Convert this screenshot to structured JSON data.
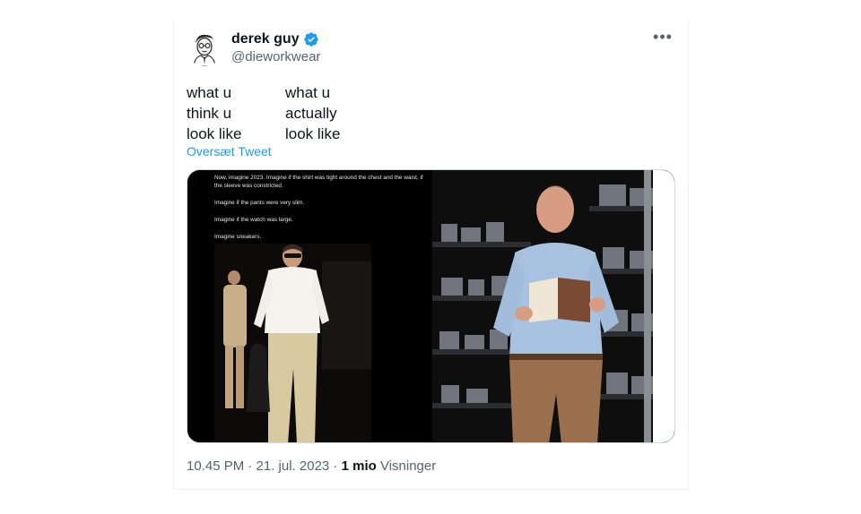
{
  "author": {
    "name": "derek guy",
    "handle": "@dieworkwear",
    "verified": true,
    "avatar_icon": "avatar-illustration"
  },
  "more_icon": "more-options-icon",
  "tweet": {
    "left_lines": [
      "what u",
      "think u",
      "look like"
    ],
    "right_lines": [
      "what u",
      "actually",
      "look like"
    ],
    "translate_label": "Oversæt Tweet"
  },
  "media": {
    "left_caption_lines": [
      "Now, imagine 2023. Imagine if the shirt was tight around the chest and the waist, if the sleeve was constricted.",
      "Imagine if the pants were very slim.",
      "Imagine if the watch was large.",
      "Imagine sneakers."
    ]
  },
  "meta": {
    "time_date": "10.45 PM · 21. jul. 2023 · ",
    "views_count": "1 mio",
    "views_label": " Visninger"
  },
  "colors": {
    "link": "#1d9bf0",
    "verified": "#1d9bf0",
    "secondary_text": "#536471",
    "primary_text": "#0f1419"
  }
}
